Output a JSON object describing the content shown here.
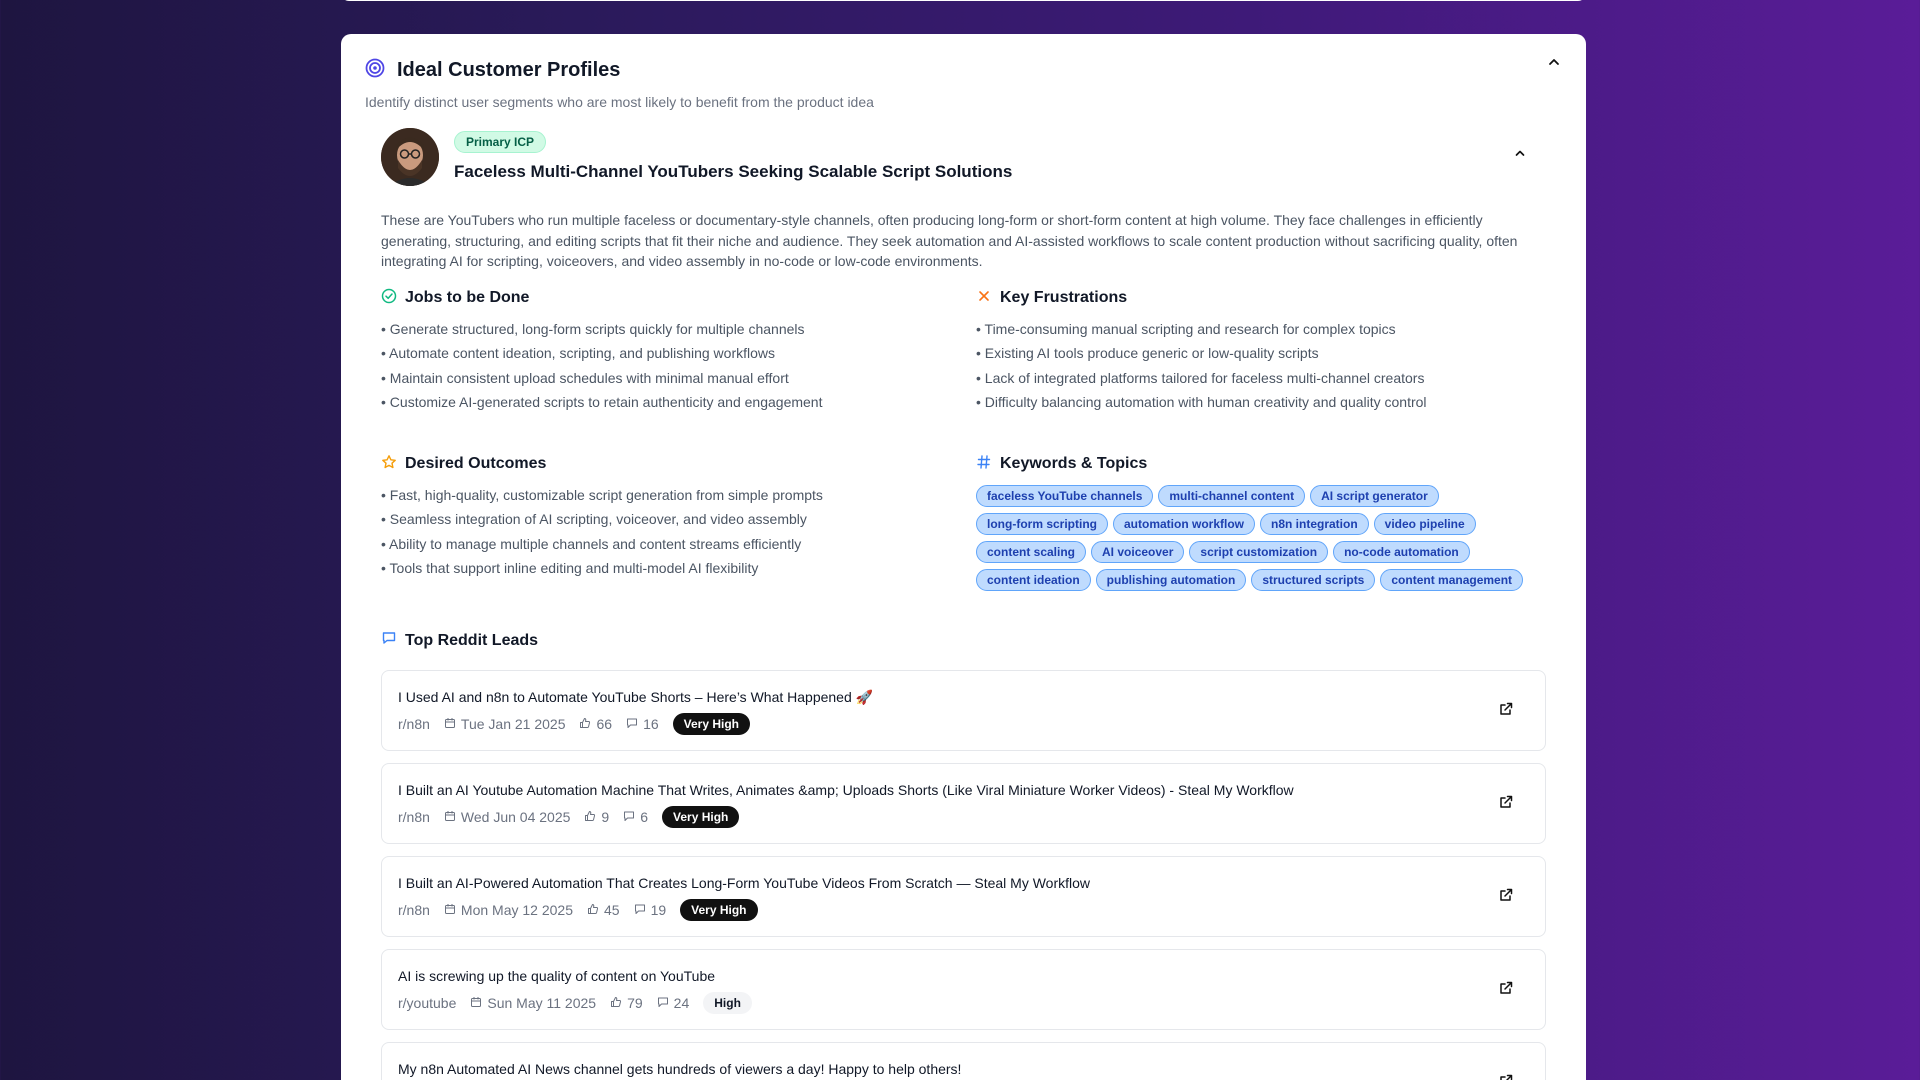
{
  "header": {
    "title": "Ideal Customer Profiles",
    "subtitle": "Identify distinct user segments who are most likely to benefit from the product idea"
  },
  "icp": {
    "badge": "Primary ICP",
    "title": "Faceless Multi-Channel YouTubers Seeking Scalable Script Solutions",
    "description": "These are YouTubers who run multiple faceless or documentary-style channels, often producing long-form or short-form content at high volume. They face challenges in efficiently generating, structuring, and editing scripts that fit their niche and audience. They seek automation and AI-assisted workflows to scale content production without sacrificing quality, often integrating AI for scripting, voiceovers, and video assembly in no-code or low-code environments."
  },
  "jobs": {
    "title": "Jobs to be Done",
    "items": [
      "• Generate structured, long-form scripts quickly for multiple channels",
      "• Automate content ideation, scripting, and publishing workflows",
      "• Maintain consistent upload schedules with minimal manual effort",
      "• Customize AI-generated scripts to retain authenticity and engagement"
    ]
  },
  "frustrations": {
    "title": "Key Frustrations",
    "items": [
      "• Time-consuming manual scripting and research for complex topics",
      "• Existing AI tools produce generic or low-quality scripts",
      "• Lack of integrated platforms tailored for faceless multi-channel creators",
      "• Difficulty balancing automation with human creativity and quality control"
    ]
  },
  "outcomes": {
    "title": "Desired Outcomes",
    "items": [
      "• Fast, high-quality, customizable script generation from simple prompts",
      "• Seamless integration of AI scripting, voiceover, and video assembly",
      "• Ability to manage multiple channels and content streams efficiently",
      "• Tools that support inline editing and multi-model AI flexibility"
    ]
  },
  "keywords": {
    "title": "Keywords & Topics",
    "tags": [
      "faceless YouTube channels",
      "multi-channel content",
      "AI script generator",
      "long-form scripting",
      "automation workflow",
      "n8n integration",
      "video pipeline",
      "content scaling",
      "AI voiceover",
      "script customization",
      "no-code automation",
      "content ideation",
      "publishing automation",
      "structured scripts",
      "content management"
    ]
  },
  "leads": {
    "title": "Top Reddit Leads",
    "items": [
      {
        "title": "I Used AI and n8n to Automate YouTube Shorts – Here’s What Happened 🚀",
        "sub": "r/n8n",
        "date": "Tue Jan 21 2025",
        "likes": "66",
        "comments": "16",
        "badge": "Very High"
      },
      {
        "title": "I Built an AI Youtube Automation Machine That Writes, Animates &amp; Uploads Shorts (Like Viral Miniature Worker Videos) - Steal My Workflow",
        "sub": "r/n8n",
        "date": "Wed Jun 04 2025",
        "likes": "9",
        "comments": "6",
        "badge": "Very High"
      },
      {
        "title": "I Built an AI-Powered Automation That Creates Long-Form YouTube Videos From Scratch — Steal My Workflow",
        "sub": "r/n8n",
        "date": "Mon May 12 2025",
        "likes": "45",
        "comments": "19",
        "badge": "Very High"
      },
      {
        "title": "AI is screwing up the quality of content on YouTube",
        "sub": "r/youtube",
        "date": "Sun May 11 2025",
        "likes": "79",
        "comments": "24",
        "badge": "High"
      },
      {
        "title": "My n8n Automated AI News channel gets hundreds of viewers a day! Happy to help others!"
      }
    ]
  },
  "colors": {
    "accent_icon": "#4f46e5",
    "check_icon": "#10b981",
    "x_icon": "#f97316",
    "star_icon": "#f59e0b",
    "hash_icon": "#3b82f6"
  }
}
